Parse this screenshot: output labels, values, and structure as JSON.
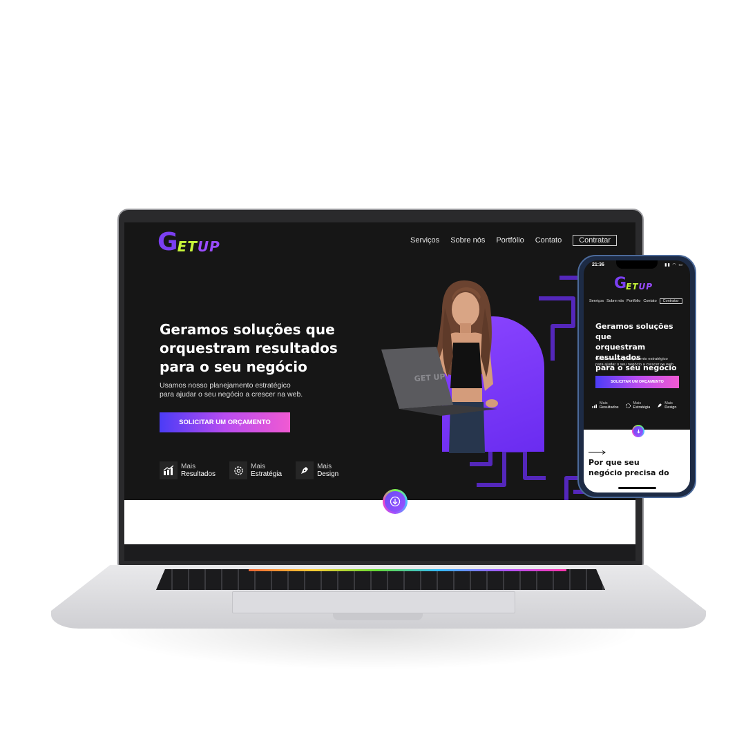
{
  "brand": {
    "logo_g": "G",
    "logo_et": "ET",
    "logo_up": "UP"
  },
  "nav": {
    "items": [
      "Serviços",
      "Sobre nós",
      "Portfólio",
      "Contato"
    ],
    "cta": "Contratar"
  },
  "hero": {
    "title_l1": "Geramos soluções que",
    "title_l2": "orquestram resultados",
    "title_l3": "para o seu negócio",
    "sub_l1": "Usamos nosso planejamento estratégico",
    "sub_l2": "para ajudar o seu negócio a crescer na web.",
    "button": "SOLICITAR UM ORÇAMENTO"
  },
  "features": [
    {
      "prefix": "Mais",
      "label": "Resultados",
      "icon": "chart-icon"
    },
    {
      "prefix": "Mais",
      "label": "Estratégia",
      "icon": "gear-icon"
    },
    {
      "prefix": "Mais",
      "label": "Design",
      "icon": "pen-icon"
    }
  ],
  "laptop_screen": {
    "laptop_brand": "GET UP"
  },
  "phone": {
    "time": "21:36",
    "section_title_l1": "Por que seu",
    "section_title_l2": "negócio precisa do"
  },
  "colors": {
    "accent": "#7b3ff2",
    "lime": "#c7f53a",
    "background": "#161616"
  }
}
